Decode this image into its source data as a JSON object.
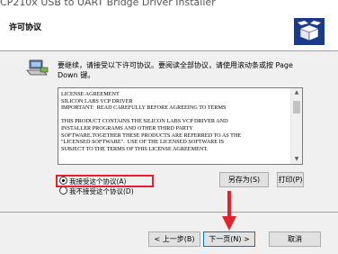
{
  "window": {
    "title": "CP210x USB to UART Bridge Driver Installer",
    "page_title": "许可协议"
  },
  "instruction": "要继续，请接受以下许可协议。要阅读全部协议，请使用滚动条或按 Page Down 键。",
  "license": {
    "text": "LICENSE AGREEMENT\nSILICON LABS VCP DRIVER\nIMPORTANT:  READ CAREFULLY BEFORE AGREEING TO TERMS\n\nTHIS PRODUCT CONTAINS THE SILICON LABS VCP DRIVER AND\nINSTALLER PROGRAMS AND OTHER THIRD PARTY\nSOFTWARE.TOGETHER THESE PRODUCTS ARE REFERRED TO AS THE\n\"LICENSED SOFTWARE\".  USE OF THE LICENSED SOFTWARE IS\nSUBJECT TO THE TERMS OF THIS LICENSE AGREEMENT."
  },
  "buttons": {
    "save_as": "另存为(S)",
    "print": "打印(P)",
    "back": "< 上一步(B)",
    "next": "下一页(N) >",
    "cancel": "取消"
  },
  "options": {
    "accept": "我接受这个协议(A)",
    "decline": "我不接受这个协议(D)",
    "selected": "accept"
  },
  "colors": {
    "highlight": "#e0242a",
    "focus_border": "#0078d7"
  },
  "icons": {
    "header": "installer-box-icon",
    "body": "computer-disk-icon",
    "annotation": "red-down-arrow"
  }
}
